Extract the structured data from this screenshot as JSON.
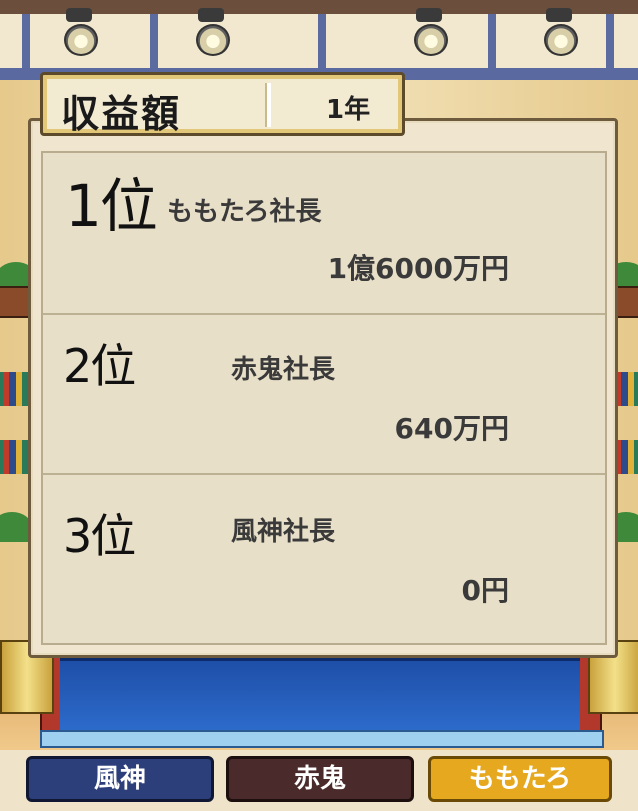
{
  "header": {
    "title": "収益額",
    "period": "1年"
  },
  "rankings": [
    {
      "rank": "1位",
      "name": "ももたろ社長",
      "amount": "1億6000万円"
    },
    {
      "rank": "2位",
      "name": "赤鬼社長",
      "amount": "640万円"
    },
    {
      "rank": "3位",
      "name": "風神社長",
      "amount": "0円"
    }
  ],
  "buttons": [
    {
      "label": "風神"
    },
    {
      "label": "赤鬼"
    },
    {
      "label": "ももたろ"
    }
  ],
  "colors": {
    "fujin": "#2c3f7a",
    "akaoni": "#4a2a2a",
    "momotaro": "#e6a81e",
    "panel": "#f0e6cf"
  }
}
